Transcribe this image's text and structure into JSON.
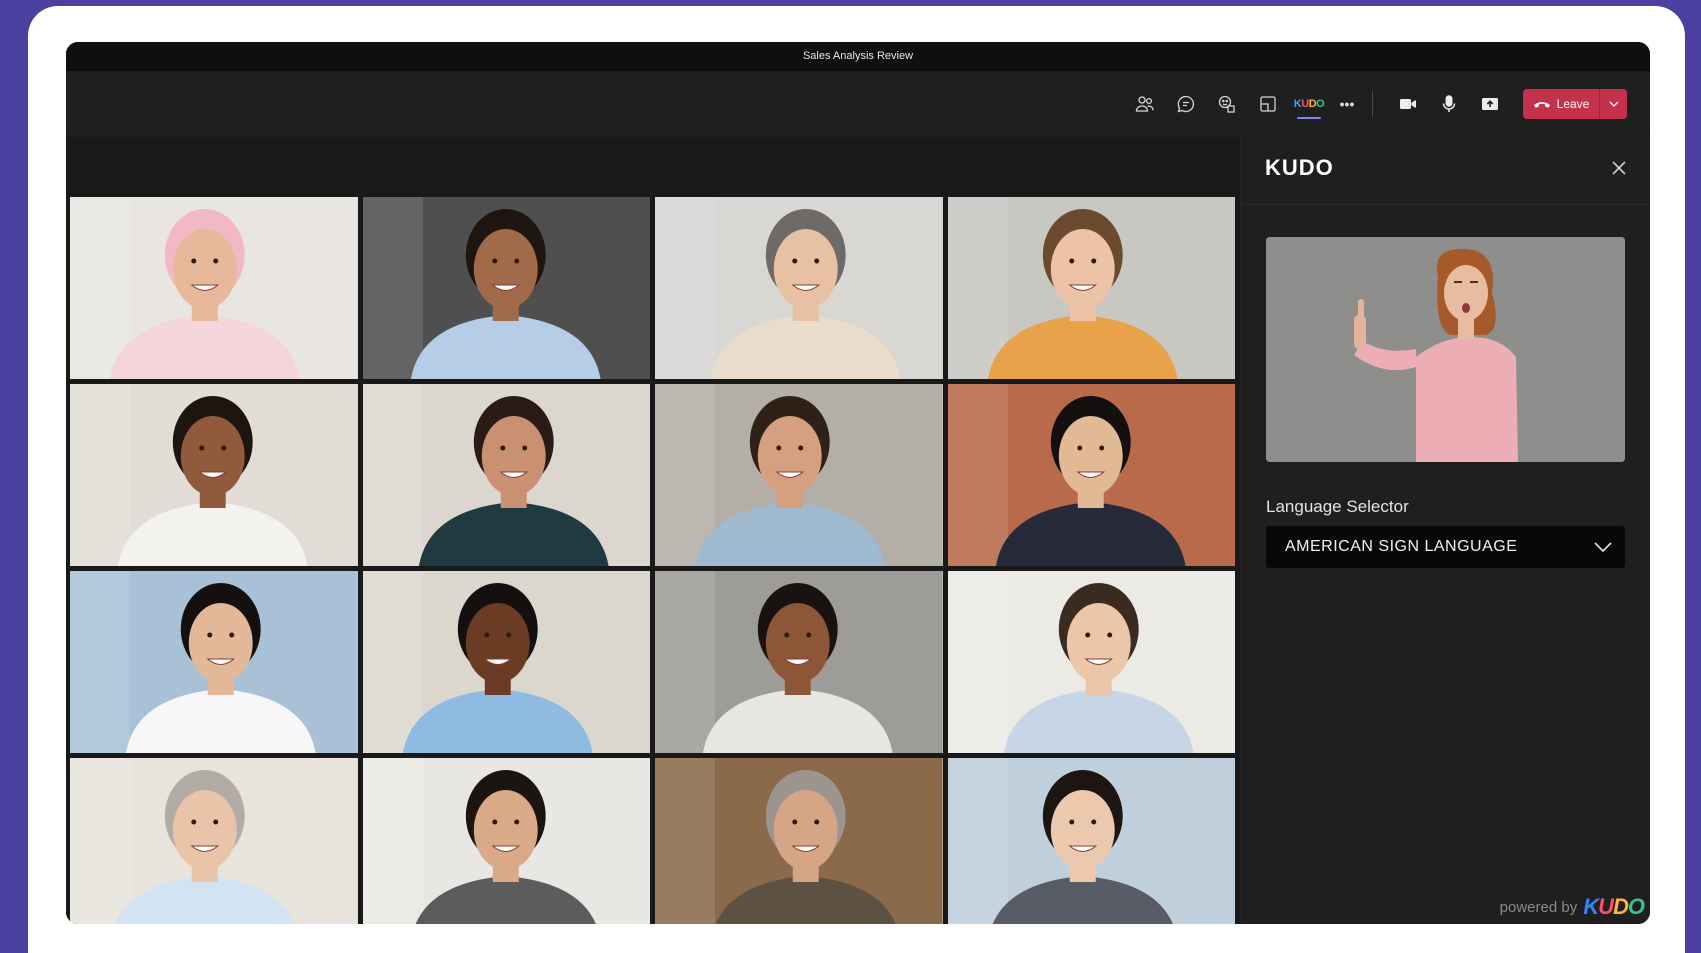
{
  "window": {
    "title": "Sales Analysis Review"
  },
  "toolbar": {
    "items": [
      {
        "name": "people-icon"
      },
      {
        "name": "chat-icon"
      },
      {
        "name": "reactions-icon"
      },
      {
        "name": "rooms-icon"
      },
      {
        "name": "kudo-app-icon",
        "label": "KUDO"
      },
      {
        "name": "more-icon",
        "label": "•••"
      },
      {
        "name": "camera-icon"
      },
      {
        "name": "mic-icon"
      },
      {
        "name": "share-icon"
      }
    ],
    "leave_label": "Leave",
    "leave_color": "#c4314b",
    "accent_color": "#7f85f5"
  },
  "participants": [
    {
      "skin": "#e7b99a",
      "hair": "#f3b8c6",
      "shirt": "#f5d5dc",
      "bg": "#e9e6e1"
    },
    {
      "skin": "#a16b4a",
      "hair": "#1e1510",
      "shirt": "#b5cde6",
      "bg": "#4f4f4f"
    },
    {
      "skin": "#e8c1a3",
      "hair": "#6e6a67",
      "shirt": "#e9dccb",
      "bg": "#d9d7d4"
    },
    {
      "skin": "#ecc3a6",
      "hair": "#6b4a2f",
      "shirt": "#e7a24a",
      "bg": "#c9c7c2"
    },
    {
      "skin": "#915a3d",
      "hair": "#1e1410",
      "shirt": "#f2f2ef",
      "bg": "#e1ddd6"
    },
    {
      "skin": "#c99172",
      "hair": "#2a1c15",
      "shirt": "#1f3a40",
      "bg": "#dbd7d0"
    },
    {
      "skin": "#d5a07f",
      "hair": "#2f2118",
      "shirt": "#9fb9cf",
      "bg": "#b3aea6"
    },
    {
      "skin": "#e2b995",
      "hair": "#151010",
      "shirt": "#262a3a",
      "bg": "#b96a4a"
    },
    {
      "skin": "#e2b899",
      "hair": "#151010",
      "shirt": "#f7f7f7",
      "bg": "#a9c1d6"
    },
    {
      "skin": "#6b3b24",
      "hair": "#141010",
      "shirt": "#8fbbe2",
      "bg": "#dcd7cd"
    },
    {
      "skin": "#8d5637",
      "hair": "#1a1210",
      "shirt": "#e8e6e0",
      "bg": "#9e9c98"
    },
    {
      "skin": "#ecc6a8",
      "hair": "#3b2a20",
      "shirt": "#c7d6e6",
      "bg": "#eceae5"
    },
    {
      "skin": "#e9c4a8",
      "hair": "#b2aca5",
      "shirt": "#d2e3f2",
      "bg": "#e8e4dc"
    },
    {
      "skin": "#d9a988",
      "hair": "#1b1512",
      "shirt": "#5c5c5c",
      "bg": "#e9e7e3"
    },
    {
      "skin": "#d6a585",
      "hair": "#9c958f",
      "shirt": "#5d5242",
      "bg": "#8a6a4a"
    },
    {
      "skin": "#ecc8ad",
      "hair": "#1d1512",
      "shirt": "#575c66",
      "bg": "#bfcfdc"
    }
  ],
  "panel": {
    "title": "KUDO",
    "language_label": "Language Selector",
    "selected_language": "AMERICAN SIGN LANGUAGE",
    "powered_by": "powered by",
    "brand": "KUDO"
  }
}
